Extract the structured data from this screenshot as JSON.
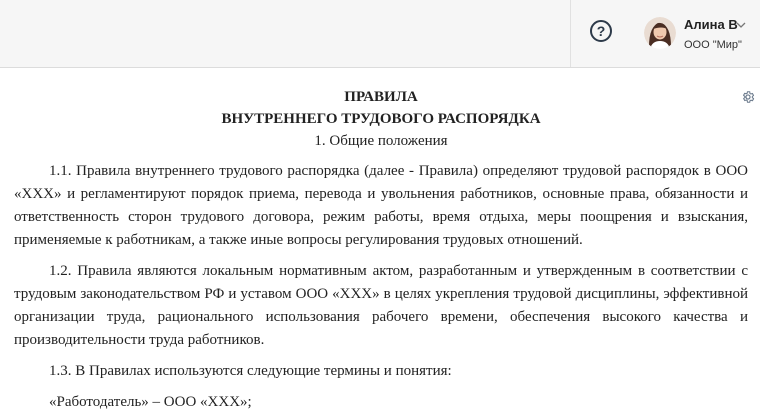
{
  "header": {
    "user_name": "Алина В",
    "org_name": "ООО \"Мир\""
  },
  "icons": {
    "help": "question-circle-icon",
    "chevron": "chevron-down-icon",
    "settings": "gear-icon"
  },
  "document": {
    "title_line1": "ПРАВИЛА",
    "title_line2": "ВНУТРЕННЕГО ТРУДОВОГО РАСПОРЯДКА",
    "section_heading": "1. Общие положения",
    "paragraphs": [
      "1.1. Правила внутреннего трудового распорядка (далее - Правила) определяют трудовой распорядок в ООО «ХХХ» и регламентируют порядок приема, перевода и увольнения работников, основные права, обязанности и ответственность сторон трудового договора, режим работы, время отдыха, меры поощрения и взыскания, применяемые к работникам, а также иные вопросы регулирования трудовых отношений.",
      "1.2. Правила являются локальным нормативным актом, разработанным и утвержденным в соответствии с трудовым законодательством РФ и уставом ООО «ХХХ» в целях укрепления трудовой дисциплины, эффективной организации труда, рационального использования рабочего времени, обеспечения высокого качества и производительности труда работников.",
      "1.3. В Правилах используются следующие термины и понятия:",
      "«Работодатель» – ООО «ХХХ»;"
    ]
  },
  "colors": {
    "header_bg": "#f6f6f6",
    "icon_dark": "#2d3a4a",
    "text": "#222222"
  }
}
